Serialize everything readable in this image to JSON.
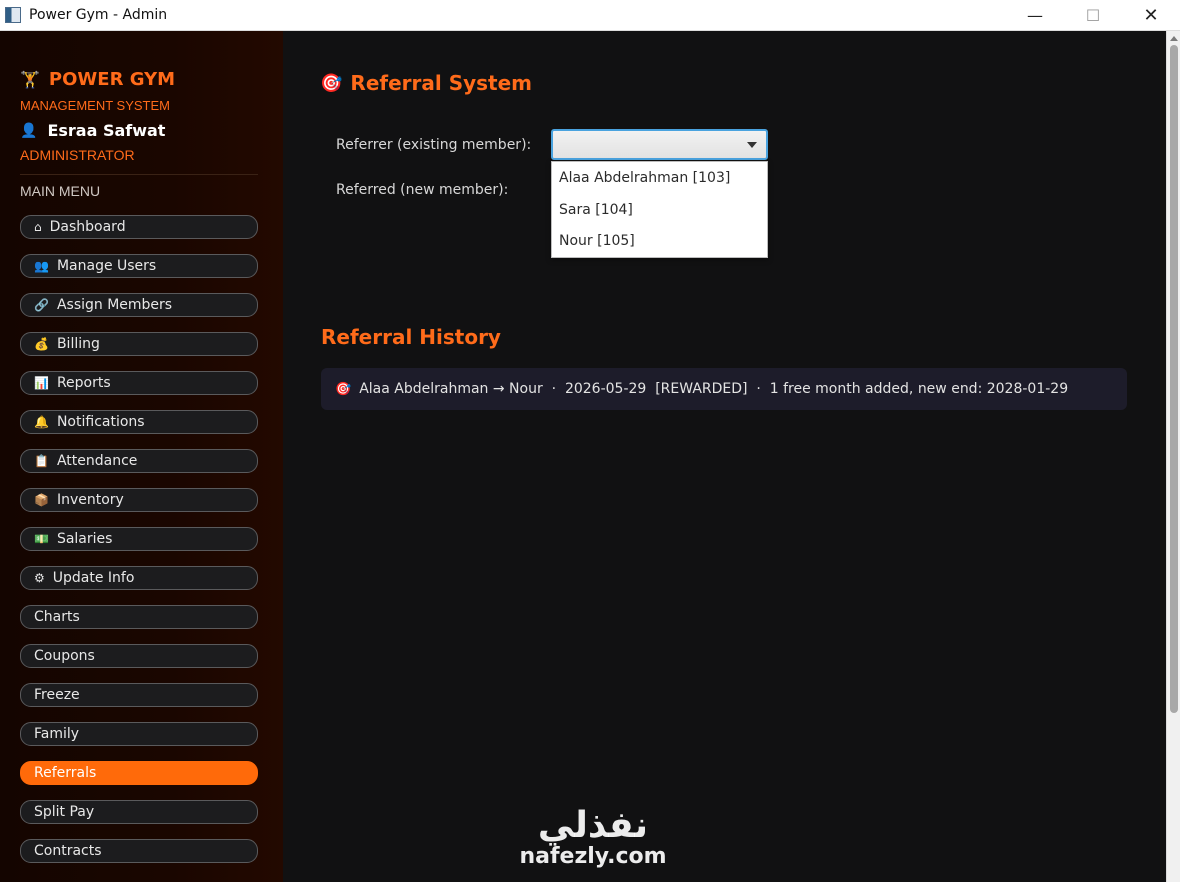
{
  "window": {
    "title": "Power Gym - Admin",
    "minimize_glyph": "—",
    "maximize_glyph": "☐",
    "close_glyph": "✕"
  },
  "sidebar": {
    "brand_icon": "🏋",
    "brand": "POWER GYM",
    "brand_sub": "MANAGEMENT SYSTEM",
    "user_icon": "👤",
    "user_name": "Esraa Safwat",
    "role": "ADMINISTRATOR",
    "menu_heading": "MAIN MENU",
    "items": [
      {
        "label": "Dashboard",
        "icon": "⌂"
      },
      {
        "label": "Manage Users",
        "icon": "👥"
      },
      {
        "label": "Assign Members",
        "icon": "🔗"
      },
      {
        "label": "Billing",
        "icon": "💰"
      },
      {
        "label": "Reports",
        "icon": "📊"
      },
      {
        "label": "Notifications",
        "icon": "🔔"
      },
      {
        "label": "Attendance",
        "icon": "📋"
      },
      {
        "label": "Inventory",
        "icon": "📦"
      },
      {
        "label": "Salaries",
        "icon": "💵"
      },
      {
        "label": "Update Info",
        "icon": "⚙"
      },
      {
        "label": "Charts",
        "icon": ""
      },
      {
        "label": "Coupons",
        "icon": ""
      },
      {
        "label": "Freeze",
        "icon": ""
      },
      {
        "label": "Family",
        "icon": ""
      },
      {
        "label": "Referrals",
        "icon": ""
      },
      {
        "label": "Split Pay",
        "icon": ""
      },
      {
        "label": "Contracts",
        "icon": ""
      }
    ],
    "active_item": "Referrals"
  },
  "main": {
    "title_icon": "🎯",
    "title": "Referral System",
    "referrer_label": "Referrer (existing member):",
    "referred_label": "Referred (new member):",
    "referrer_value": "",
    "dropdown_options": [
      "Alaa Abdelrahman [103]",
      "Sara [104]",
      "Nour [105]"
    ],
    "history_title": "Referral History",
    "history": [
      {
        "icon": "🎯",
        "text": "Alaa Abdelrahman → Nour  ·  2026-05-29  [REWARDED]  ·  1 free month added, new end: 2028-01-29"
      }
    ]
  },
  "watermark": {
    "arabic": "نفذلي",
    "latin": "nafezly.com"
  },
  "colors": {
    "accent": "#ff6a0a",
    "sidebar_bg": "#1a0600",
    "main_bg": "#111112",
    "history_row_bg": "#1d1c2a",
    "combo_focus": "#4aa3df"
  }
}
